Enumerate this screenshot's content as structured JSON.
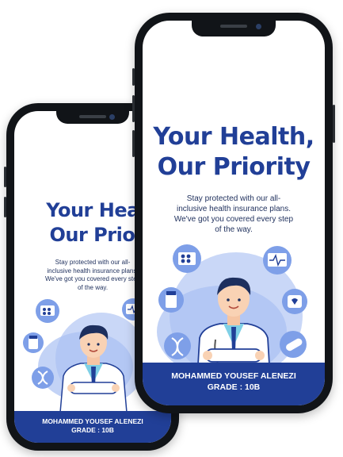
{
  "colors": {
    "accent": "#213f97",
    "accent_light": "#7e9fe8",
    "frame": "#111418"
  },
  "poster": {
    "title_line1": "Your Health,",
    "title_line2": "Our Priority",
    "subtitle_line1": "Stay protected with our all-",
    "subtitle_line2": "inclusive health insurance plans.",
    "subtitle_line3": "We've got you covered every step",
    "subtitle_line4": "of the way.",
    "student_name": "MOHAMMED YOUSEF ALENEZI",
    "grade": "GRADE : 10B"
  },
  "icons": [
    "pill-blister-icon",
    "ecg-monitor-icon",
    "medicine-bottle-icon",
    "heartbeat-icon",
    "dna-icon",
    "capsule-icon",
    "doctor-illustration"
  ]
}
